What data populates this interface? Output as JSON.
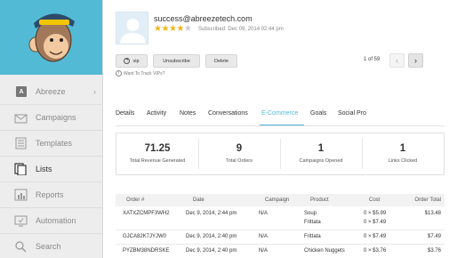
{
  "sidebar": {
    "account_initial": "A",
    "items": [
      {
        "label": "Abreeze",
        "icon": "account-icon"
      },
      {
        "label": "Campaigns",
        "icon": "envelope-icon"
      },
      {
        "label": "Templates",
        "icon": "template-icon"
      },
      {
        "label": "Lists",
        "icon": "lists-icon"
      },
      {
        "label": "Reports",
        "icon": "bar-chart-icon"
      },
      {
        "label": "Automation",
        "icon": "automation-icon"
      },
      {
        "label": "Search",
        "icon": "search-icon"
      }
    ]
  },
  "subscriber": {
    "email": "success@abreezetech.com",
    "rating": 4,
    "rating_max": 5,
    "subscribed": "Subscribed: Dec 09, 2014 02:44 pm"
  },
  "actions": {
    "vip": "vip",
    "unsubscribe": "Unsubscribe",
    "delete": "Delete",
    "vip_link": "Want To Track VIPs?"
  },
  "pager": {
    "count": "1 of 59",
    "prev": "‹",
    "next": "›"
  },
  "tabs": [
    "Details",
    "Activity",
    "Notes",
    "Conversations",
    "E-Commerce",
    "Goals",
    "Social Pro"
  ],
  "active_tab": "E-Commerce",
  "stats": [
    {
      "value": "71.25",
      "label": "Total Revenue Generated"
    },
    {
      "value": "9",
      "label": "Total Orders"
    },
    {
      "value": "1",
      "label": "Campaigns Opened"
    },
    {
      "value": "1",
      "label": "Links Clicked"
    }
  ],
  "orders": {
    "columns": [
      "Order #",
      "Date",
      "Campaign",
      "Product",
      "Cost",
      "Order Total"
    ],
    "rows": [
      {
        "order": "XATXZCMPF3WH2",
        "date": "Dec 9, 2014, 2:44 pm",
        "campaign": "N/A",
        "products": [
          "Soup",
          "Frittata"
        ],
        "costs": [
          "0 × $5.99",
          "0 × $7.49"
        ],
        "total": "$13.48"
      },
      {
        "order": "GJCA82K7JYJW0",
        "date": "Dec 9, 2014, 2:40 pm",
        "campaign": "N/A",
        "products": [
          "Frittata"
        ],
        "costs": [
          "0 × $7.49"
        ],
        "total": "$7.49"
      },
      {
        "order": "PYZBM38NDRSKE",
        "date": "Dec 9, 2014, 2:40 pm",
        "campaign": "N/A",
        "products": [
          "Chicken Nuggets"
        ],
        "costs": [
          "0 × $3.76"
        ],
        "total": "$3.76"
      }
    ]
  },
  "colors": {
    "accent": "#52bad5",
    "star": "#f2b51c",
    "sidebar_bg": "#ededed"
  }
}
